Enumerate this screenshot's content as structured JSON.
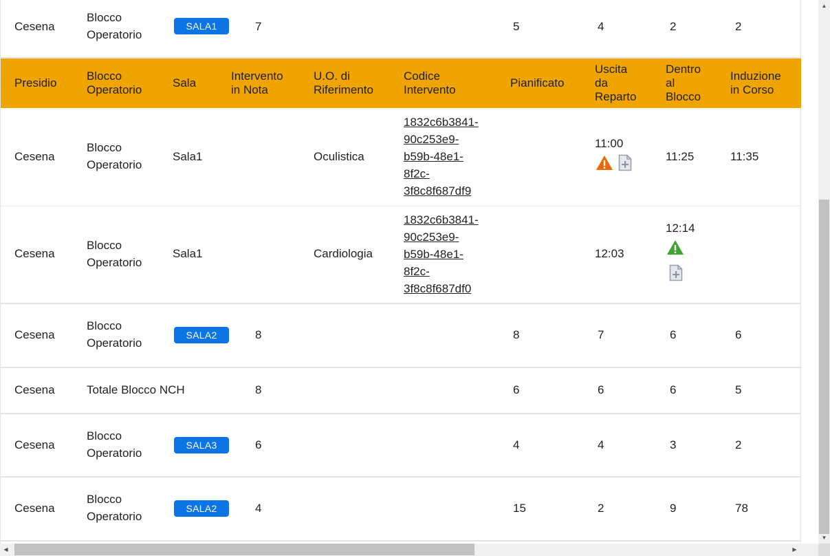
{
  "header": {
    "presidio": "Presidio",
    "blocco_line1": "Blocco",
    "blocco_line2": "Operatorio",
    "sala": "Sala",
    "intervento_line1": "Intervento",
    "intervento_line2": "in Nota",
    "uo_line1": "U.O. di",
    "uo_line2": "Riferimento",
    "codice_line1": "Codice",
    "codice_line2": "Intervento",
    "pianificato": "Pianificato",
    "uscita_line1": "Uscita",
    "uscita_line2": "da",
    "uscita_line3": "Reparto",
    "dentro_line1": "Dentro",
    "dentro_line2": "al",
    "dentro_line3": "Blocco",
    "induzione_line1": "Induzione",
    "induzione_line2": "in Corso"
  },
  "summary_rows": [
    {
      "presidio": "Cesena",
      "blocco_line1": "Blocco",
      "blocco_line2": "Operatorio",
      "sala": "SALA1",
      "intervento": "7",
      "pianificato": "5",
      "uscita": "4",
      "dentro": "2",
      "induzione": "2"
    },
    {
      "presidio": "Cesena",
      "blocco_line1": "Blocco",
      "blocco_line2": "Operatorio",
      "sala": "SALA2",
      "intervento": "8",
      "pianificato": "8",
      "uscita": "7",
      "dentro": "6",
      "induzione": "6"
    },
    {
      "presidio": "Cesena",
      "blocco": "Totale Blocco NCH",
      "intervento": "8",
      "pianificato": "6",
      "uscita": "6",
      "dentro": "6",
      "induzione": "5"
    },
    {
      "presidio": "Cesena",
      "blocco_line1": "Blocco",
      "blocco_line2": "Operatorio",
      "sala": "SALA3",
      "intervento": "6",
      "pianificato": "4",
      "uscita": "4",
      "dentro": "3",
      "induzione": "2"
    },
    {
      "presidio": "Cesena",
      "blocco_line1": "Blocco",
      "blocco_line2": "Operatorio",
      "sala": "SALA2",
      "intervento": "4",
      "pianificato": "15",
      "uscita": "2",
      "dentro": "9",
      "induzione": "78"
    }
  ],
  "detail_rows": [
    {
      "presidio": "Cesena",
      "blocco_line1": "Blocco",
      "blocco_line2": "Operatorio",
      "sala": "Sala1",
      "uo": "Oculistica",
      "code_lines": [
        "1832c6b3841-",
        "90c253e9-",
        "b59b-48e1-",
        "8f2c-",
        "3f8c8f687df9"
      ],
      "uscita": "11:00",
      "dentro": "11:25",
      "induzione": "11:35"
    },
    {
      "presidio": "Cesena",
      "blocco_line1": "Blocco",
      "blocco_line2": "Operatorio",
      "sala": "Sala1",
      "uo": "Cardiologia",
      "code_lines": [
        "1832c6b3841-",
        "90c253e9-",
        "b59b-48e1-",
        "8f2c-",
        "3f8c8f687df0"
      ],
      "uscita": "12:03",
      "dentro": "12:14",
      "induzione": ""
    }
  ],
  "colors": {
    "header_bg": "#f0a400",
    "badge_bg": "#0d74e5",
    "warning_orange": "#ee6a00",
    "warning_green": "#3fa535",
    "doc_icon": "#9aa0ab"
  },
  "icons": {
    "warning": "warning-triangle-icon",
    "document": "document-add-icon"
  }
}
